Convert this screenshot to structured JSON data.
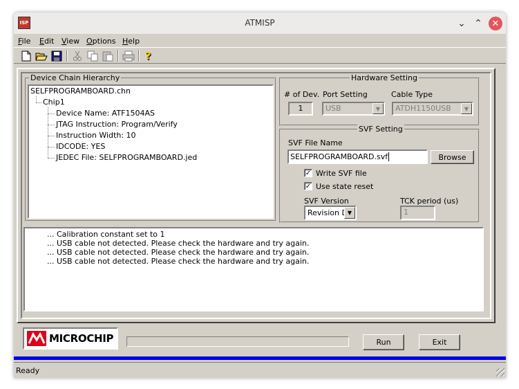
{
  "window": {
    "title": "ATMISP",
    "icon_text": "ISP"
  },
  "titlebar_buttons": {
    "minimize": "⌄",
    "maximize": "⌃",
    "close": "✕"
  },
  "menu": [
    "File",
    "Edit",
    "View",
    "Options",
    "Help"
  ],
  "menu_underline": [
    "F",
    "E",
    "V",
    "O",
    "H"
  ],
  "toolbar": [
    "new-icon",
    "open-icon",
    "save-icon",
    "cut-icon",
    "copy-icon",
    "paste-icon",
    "print-icon",
    "help-icon"
  ],
  "device_chain": {
    "title": "Device Chain Hierarchy",
    "root": "SELFPROGRAMBOARD.chn",
    "chip": "Chip1",
    "details": [
      "Device Name: ATF1504AS",
      "JTAG Instruction: Program/Verify",
      "Instruction Width: 10",
      "IDCODE: YES",
      "JEDEC File: SELFPROGRAMBOARD.jed"
    ]
  },
  "hardware": {
    "title": "Hardware Setting",
    "num_dev_label": "# of Dev.",
    "num_dev_value": "1",
    "port_label": "Port Setting",
    "port_value": "USB",
    "cable_label": "Cable Type",
    "cable_value": "ATDH1150USB"
  },
  "svf": {
    "title": "SVF Setting",
    "file_label": "SVF File Name",
    "file_value": "SELFPROGRAMBOARD.svf",
    "browse": "Browse",
    "write_label": "Write SVF file",
    "write_checked": true,
    "reset_label": "Use state reset",
    "reset_checked": true,
    "version_label": "SVF Version",
    "version_value": "Revision D",
    "tck_label": "TCK period (us)",
    "tck_value": "1"
  },
  "log": [
    "...  Calibration constant set to 1",
    "...  USB cable not detected. Please check the hardware and try again.",
    "...  USB cable not detected. Please check the hardware and try again.",
    "...  USB cable not detected. Please check the hardware and try again."
  ],
  "logo": {
    "text": "MICROCHIP"
  },
  "buttons": {
    "run": "Run",
    "exit": "Exit"
  },
  "progress": 0,
  "status": "Ready",
  "colors": {
    "accent_bar": "#0000e6",
    "close_button": "#e0575b"
  }
}
